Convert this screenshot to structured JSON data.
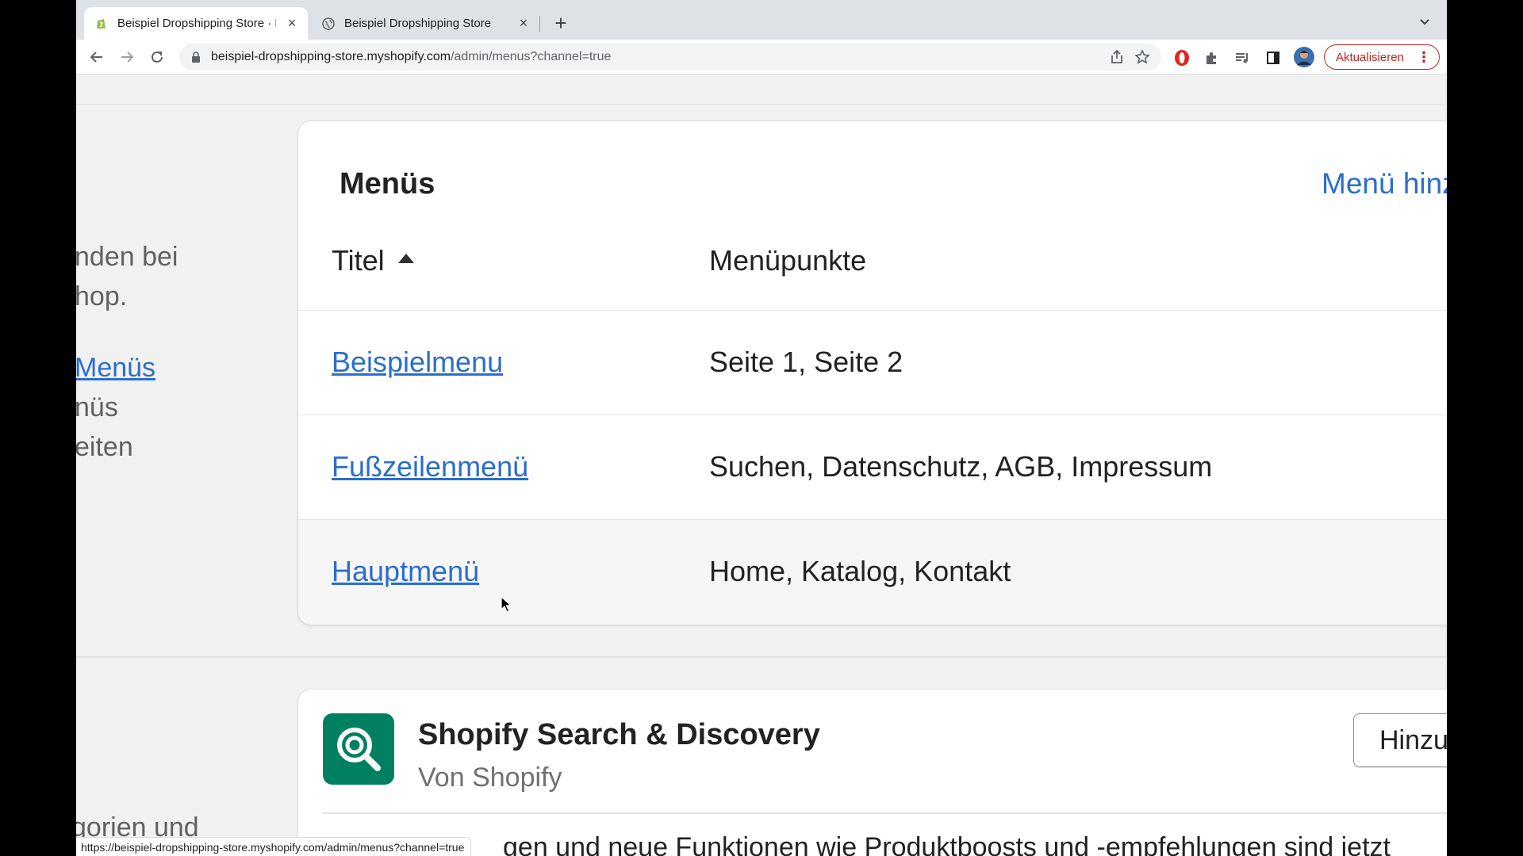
{
  "browser": {
    "tabs": [
      {
        "title": "Beispiel Dropshipping Store · M",
        "active": true,
        "close": "×"
      },
      {
        "title": "Beispiel Dropshipping Store",
        "active": false,
        "close": "×"
      }
    ],
    "new_tab_label": "+",
    "url_host": "beispiel-dropshipping-store.myshopify.com",
    "url_path": "/admin/menus?channel=true",
    "update_button": "Aktualisieren",
    "update_dots": "⋮",
    "status_url": "https://beispiel-dropshipping-store.myshopify.com/admin/menus?channel=true"
  },
  "sidebar_text": {
    "line1": "nden bei",
    "line2": "hop.",
    "link": "Menüs",
    "line4": "nüs",
    "line5": "eiten",
    "bottom": "gorien und"
  },
  "menus_card": {
    "title": "Menüs",
    "add_link": "Menü hinzufügen",
    "columns": {
      "title": "Titel",
      "items": "Menüpunkte"
    },
    "rows": [
      {
        "title": "Beispielmenu",
        "items": "Seite 1, Seite 2"
      },
      {
        "title": "Fußzeilenmenü",
        "items": "Suchen, Datenschutz, AGB, Impressum"
      },
      {
        "title": "Hauptmenü",
        "items": "Home, Katalog, Kontakt"
      }
    ]
  },
  "app_card": {
    "name": "Shopify Search & Discovery",
    "vendor": "Von Shopify",
    "add_button": "Hinzufügen",
    "description": "gen und neue Funktionen wie Produktboosts und -empfehlungen sind jetzt"
  },
  "colors": {
    "link": "#2c6ecb",
    "app_icon_bg": "#008060",
    "update_red": "#c5221f"
  }
}
